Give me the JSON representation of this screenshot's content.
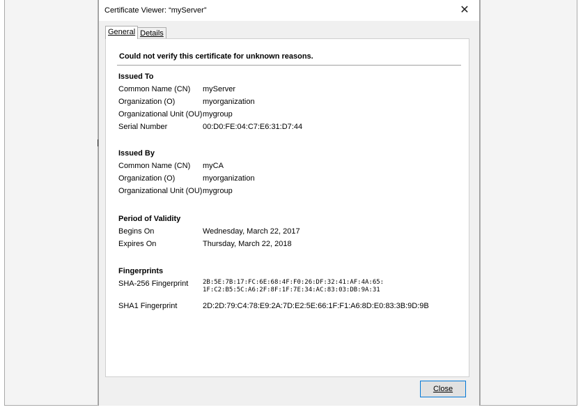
{
  "dialog": {
    "title": "Certificate Viewer: “myServer”",
    "close_icon": "close-icon"
  },
  "tabs": [
    {
      "label": "General",
      "active": true
    },
    {
      "label": "Details",
      "active": false
    }
  ],
  "general": {
    "warning": "Could not verify this certificate for unknown reasons.",
    "issued_to": {
      "title": "Issued To",
      "rows": [
        {
          "label": "Common Name (CN)",
          "value": "myServer"
        },
        {
          "label": "Organization (O)",
          "value": "myorganization"
        },
        {
          "label": "Organizational Unit (OU)",
          "value": "mygroup"
        },
        {
          "label": "Serial Number",
          "value": "00:D0:FE:04:C7:E6:31:D7:44"
        }
      ]
    },
    "issued_by": {
      "title": "Issued By",
      "rows": [
        {
          "label": "Common Name (CN)",
          "value": "myCA"
        },
        {
          "label": "Organization (O)",
          "value": "myorganization"
        },
        {
          "label": "Organizational Unit (OU)",
          "value": "mygroup"
        }
      ]
    },
    "validity": {
      "title": "Period of Validity",
      "rows": [
        {
          "label": "Begins On",
          "value": "Wednesday, March 22, 2017"
        },
        {
          "label": "Expires On",
          "value": "Thursday, March 22, 2018"
        }
      ]
    },
    "fingerprints": {
      "title": "Fingerprints",
      "sha256_label": "SHA-256 Fingerprint",
      "sha256_line1": "2B:5E:7B:17:FC:6E:68:4F:F0:26:DF:32:41:AF:4A:65:",
      "sha256_line2": "1F:C2:B5:5C:A6:2F:8F:1F:7E:34:AC:83:03:DB:9A:31",
      "sha1_label": "SHA1 Fingerprint",
      "sha1_value": "2D:2D:79:C4:78:E9:2A:7D:E2:5E:66:1F:F1:A6:8D:E0:83:3B:9D:9B"
    }
  },
  "buttons": {
    "close_label": "Close"
  }
}
